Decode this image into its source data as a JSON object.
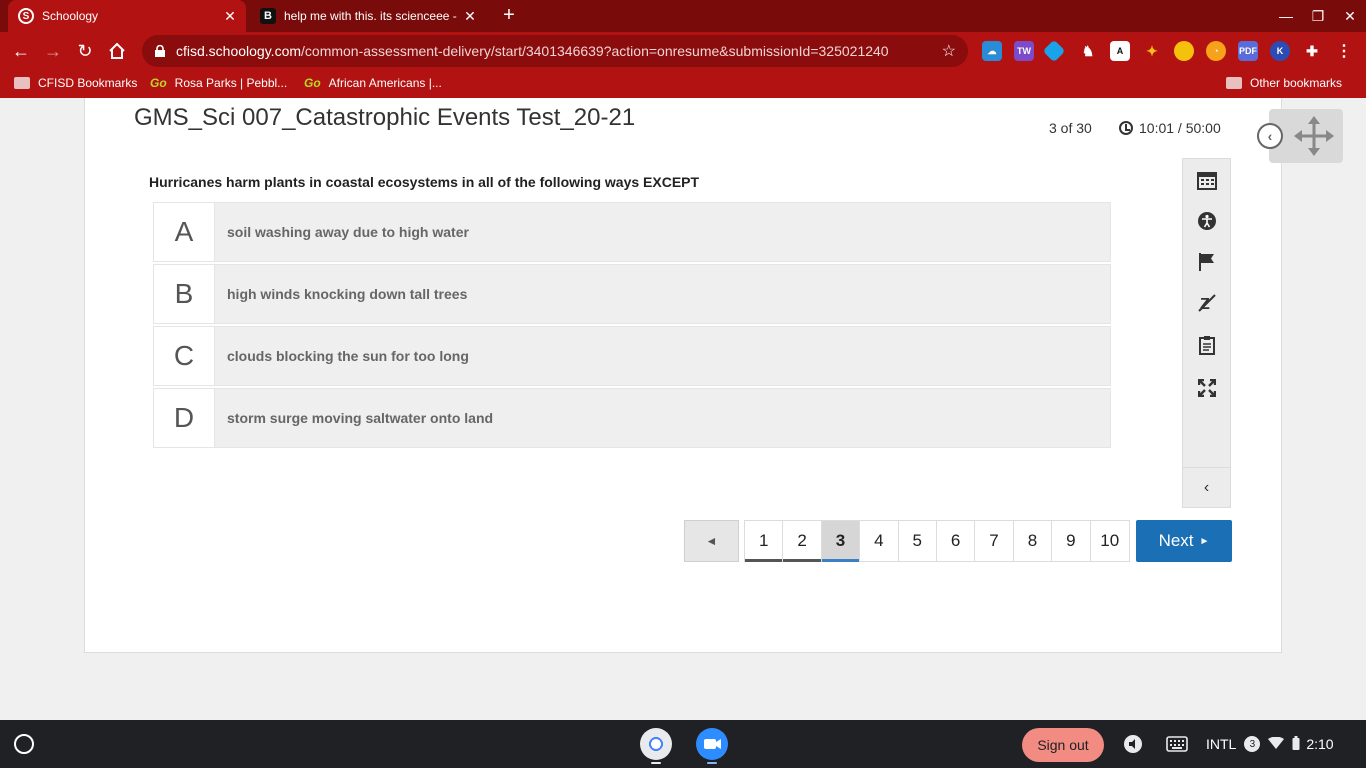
{
  "browser": {
    "tabs": [
      {
        "title": "Schoology",
        "favicon": "S"
      },
      {
        "title": "help me with this. its scienceee -",
        "favicon": "B"
      }
    ],
    "url_host": "cfisd.schoology.com",
    "url_path": "/common-assessment-delivery/start/3401346639?action=onresume&submissionId=325021240",
    "bookmarks": [
      {
        "label": "CFISD Bookmarks",
        "icon": "folder-icon"
      },
      {
        "label": "Rosa Parks | Pebbl...",
        "icon": "go-icon",
        "prefix": "Go"
      },
      {
        "label": "African Americans |...",
        "icon": "go-icon",
        "prefix": "Go"
      }
    ],
    "other_bookmarks": "Other bookmarks",
    "theme_color": "#b31212"
  },
  "assessment": {
    "title": "GMS_Sci 007_Catastrophic Events Test_20-21",
    "progress": "3 of 30",
    "timer": "10:01 / 50:00",
    "question": "Hurricanes harm plants in coastal ecosystems in all of the following ways EXCEPT",
    "answers": [
      {
        "letter": "A",
        "text": "soil washing away due to high water"
      },
      {
        "letter": "B",
        "text": "high winds knocking down tall trees"
      },
      {
        "letter": "C",
        "text": "clouds blocking the sun for too long"
      },
      {
        "letter": "D",
        "text": "storm surge moving saltwater onto land"
      }
    ],
    "pages": [
      "1",
      "2",
      "3",
      "4",
      "5",
      "6",
      "7",
      "8",
      "9",
      "10"
    ],
    "current_page": "3",
    "next_label": "Next",
    "accent_color": "#1a6fb5"
  },
  "tools": [
    "calendar-icon",
    "accessibility-icon",
    "flag-icon",
    "eliminate-icon",
    "notepad-icon",
    "fullscreen-icon"
  ],
  "shelf": {
    "signout_label": "Sign out",
    "locale": "INTL",
    "notification_count": "3",
    "time": "2:10"
  }
}
